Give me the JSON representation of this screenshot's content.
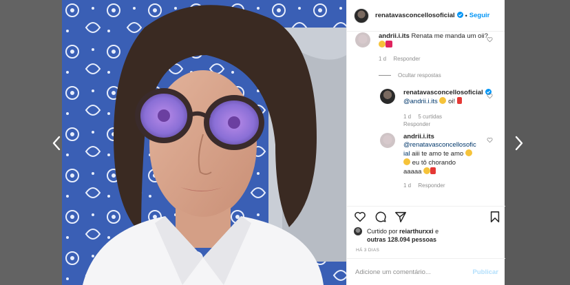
{
  "header": {
    "username": "renatavasconcellosoficial",
    "separator": "•",
    "follow_label": "Seguir"
  },
  "comments": [
    {
      "username": "andrii.i.its",
      "text": "Renata me manda um oii?",
      "emojis": [
        "smiling-face-with-heart-eyes",
        "two-hearts"
      ],
      "time": "1 d",
      "reply_label": "Responder"
    }
  ],
  "hide_replies_label": "Ocultar respostas",
  "replies": [
    {
      "username": "renatavasconcellosoficial",
      "mention": "@andrii.i.its",
      "text": "oi!",
      "emojis": [
        "blowing-kiss-face",
        "red-heart"
      ],
      "time": "1 d",
      "likes": "5 curtidas",
      "reply_label": "Responder"
    },
    {
      "username": "andrii.i.its",
      "mention_line1": "@renatavasconcellosofic",
      "mention_line2": "ial",
      "text_line2": "aiii te amo te amo",
      "text_line3": "eu tô chorando",
      "text_line4": "aaaaa",
      "emojis": [
        "smiling-face-with-heart-eyes",
        "smiling-face-with-heart-eyes",
        "loudly-crying-face",
        "red-heart"
      ],
      "time": "1 d",
      "reply_label": "Responder"
    }
  ],
  "actions": {
    "icons": [
      "heart-icon",
      "comment-icon",
      "share-icon",
      "bookmark-icon"
    ]
  },
  "likes": {
    "prefix": "Curtido por",
    "user": "reiarthurxxi",
    "connector": "e",
    "others": "outras 128.094 pessoas"
  },
  "time_ago": "HÁ 3 DIAS",
  "comment_box": {
    "placeholder": "Adicione um comentário...",
    "publish_label": "Publicar"
  },
  "colors": {
    "accent": "#0095f6",
    "publish_disabled": "#b2dffc",
    "muted": "#8e8e8e",
    "text": "#262626"
  }
}
